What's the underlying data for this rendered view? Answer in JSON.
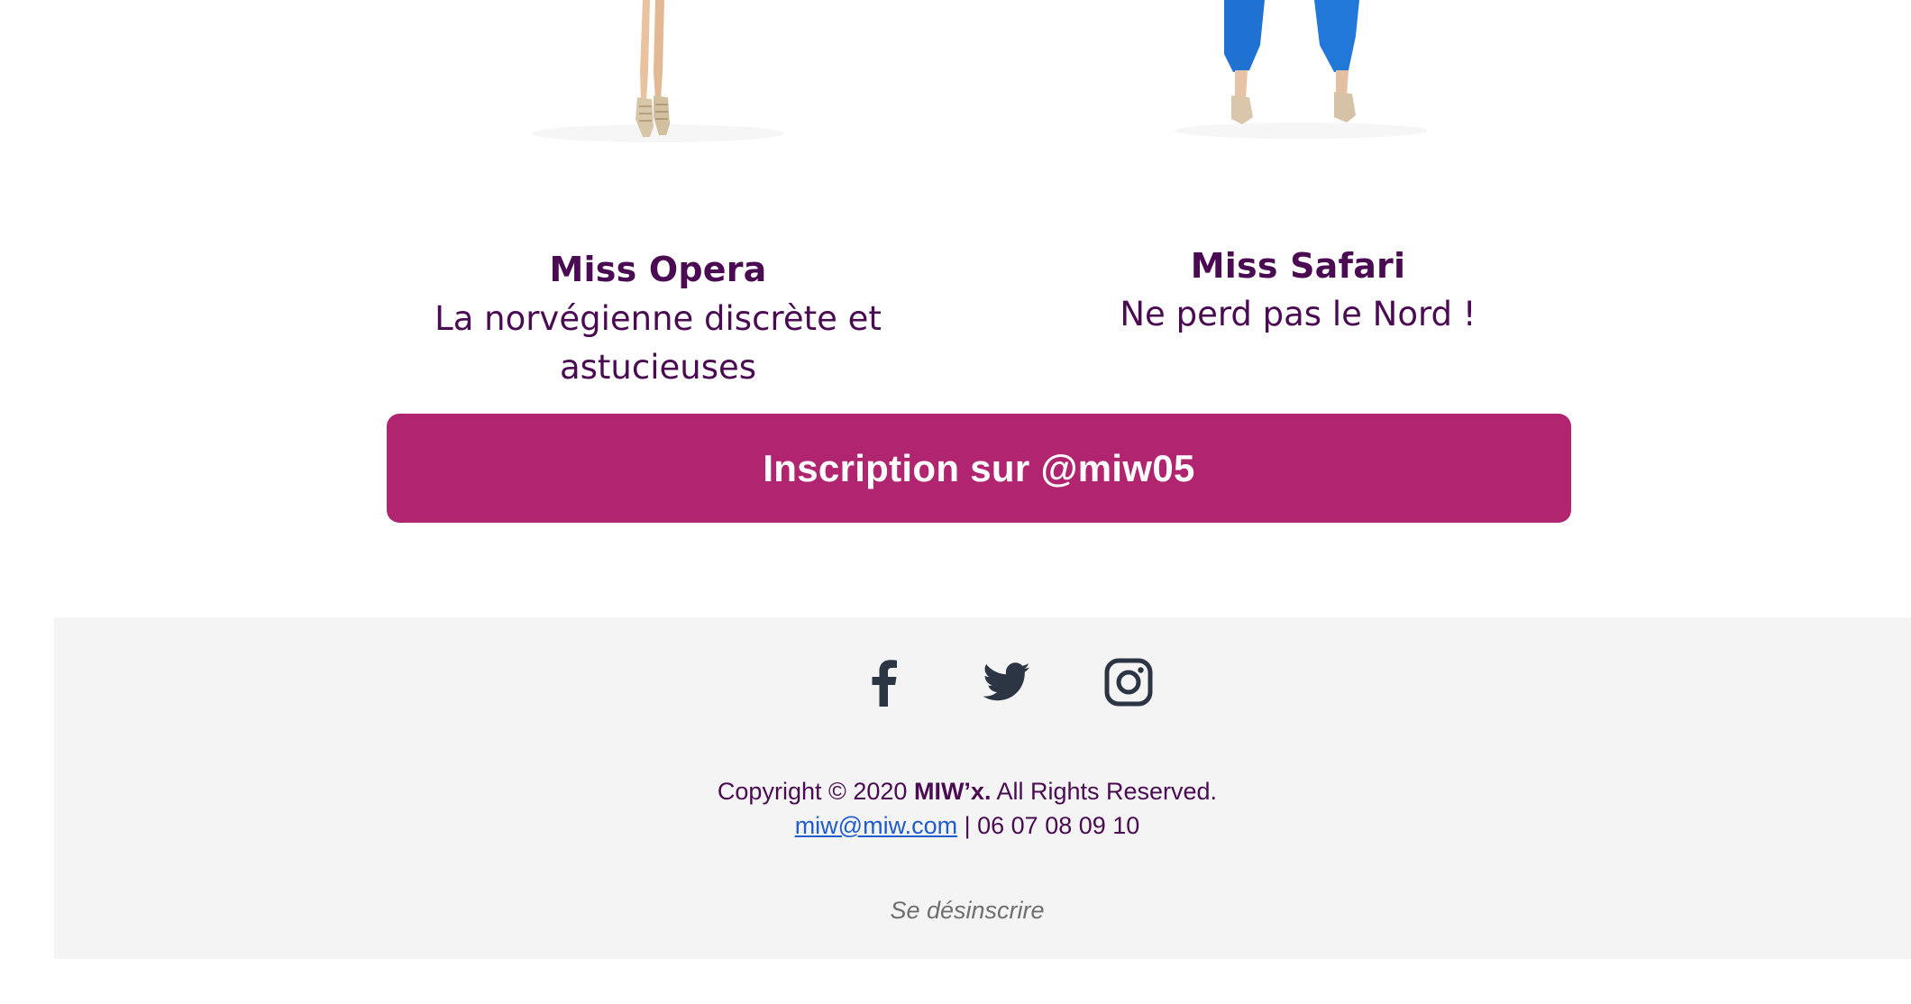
{
  "products": [
    {
      "title": "Miss Opera",
      "description_line1": "La norvégienne discrète et",
      "description_line2": "astucieuses",
      "image_icon": "legs-heels-image"
    },
    {
      "title": "Miss Safari",
      "description_line1": "Ne perd pas le Nord !",
      "image_icon": "blue-pants-heels-image"
    }
  ],
  "cta": {
    "label": "Inscription sur @miw05",
    "color": "#b12470"
  },
  "footer": {
    "social": [
      {
        "name": "facebook",
        "icon": "facebook-icon"
      },
      {
        "name": "twitter",
        "icon": "twitter-icon"
      },
      {
        "name": "instagram",
        "icon": "instagram-icon"
      }
    ],
    "copyright_prefix": "Copyright © 2020 ",
    "brand": "MIW’x.",
    "copyright_suffix": " All Rights Reserved.",
    "email": "miw@miw.com",
    "separator": " | ",
    "phone": "06 07 08 09 10",
    "unsubscribe": "Se désinscrire"
  },
  "colors": {
    "text_primary": "#4a0b52",
    "footer_bg": "#f4f4f4",
    "link": "#1f5dcc",
    "icon": "#2b3544"
  }
}
